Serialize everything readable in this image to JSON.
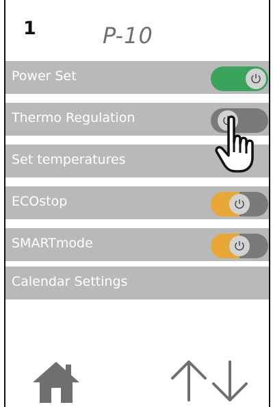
{
  "header": {
    "page_number": "1",
    "program": "P-10"
  },
  "menu": {
    "items": [
      {
        "label": "Power Set",
        "toggle": "on",
        "toggle_color": "#3aa35c"
      },
      {
        "label": "Thermo Regulation",
        "toggle": "off",
        "toggle_color": "#7a7a7a"
      },
      {
        "label": "Set temperatures"
      },
      {
        "label": "ECOstop",
        "toggle": "on",
        "toggle_color": "#e8a838"
      },
      {
        "label": "SMARTmode",
        "toggle": "on",
        "toggle_color": "#e8a838"
      },
      {
        "label": "Calendar Settings"
      }
    ]
  },
  "icons": {
    "toggle_knob": "power-icon",
    "cursor": "hand-pointer-icon",
    "home": "home-icon",
    "scroll": "up-down-arrows-icon"
  },
  "colors": {
    "row_bg": "#b9b9b9",
    "title_gray": "#6f6f6f",
    "icon_gray": "#6f6f6f"
  }
}
